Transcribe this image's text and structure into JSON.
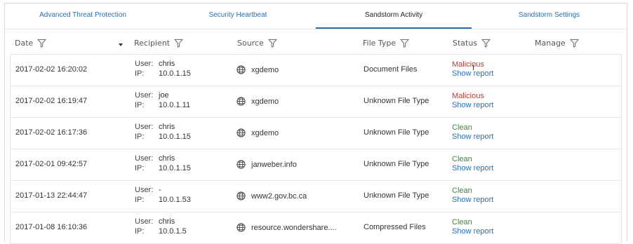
{
  "tabs": [
    {
      "label": "Advanced Threat Protection"
    },
    {
      "label": "Security Heartbeat"
    },
    {
      "label": "Sandstorm Activity"
    },
    {
      "label": "Sandstorm Settings"
    }
  ],
  "columns": {
    "date": "Date",
    "recipient": "Recipient",
    "source": "Source",
    "file_type": "File Type",
    "status": "Status",
    "manage": "Manage"
  },
  "labels": {
    "user": "User:",
    "ip": "IP:",
    "show_report": "Show report"
  },
  "rows": [
    {
      "date": "2017-02-02 16:20:02",
      "user": "chris",
      "ip": "10.0.1.15",
      "source": "xgdemo",
      "file_type": "Document Files",
      "status": "Malicious"
    },
    {
      "date": "2017-02-02 16:19:47",
      "user": "joe",
      "ip": "10.0.1.11",
      "source": "xgdemo",
      "file_type": "Unknown File Type",
      "status": "Malicious"
    },
    {
      "date": "2017-02-02 16:17:36",
      "user": "chris",
      "ip": "10.0.1.15",
      "source": "xgdemo",
      "file_type": "Unknown File Type",
      "status": "Clean"
    },
    {
      "date": "2017-02-01 09:42:57",
      "user": "chris",
      "ip": "10.0.1.15",
      "source": "janweber.info",
      "file_type": "Unknown File Type",
      "status": "Clean"
    },
    {
      "date": "2017-01-13 22:44:47",
      "user": "-",
      "ip": "10.0.1.53",
      "source": "www2.gov.bc.ca",
      "file_type": "Unknown File Type",
      "status": "Clean"
    },
    {
      "date": "2017-01-08 16:10:36",
      "user": "chris",
      "ip": "10.0.1.5",
      "source": "resource.wondershare....",
      "file_type": "Compressed Files",
      "status": "Clean"
    }
  ],
  "colors": {
    "accent": "#2a6fb0",
    "malicious": "#c0392b",
    "clean": "#3b8a3b"
  }
}
